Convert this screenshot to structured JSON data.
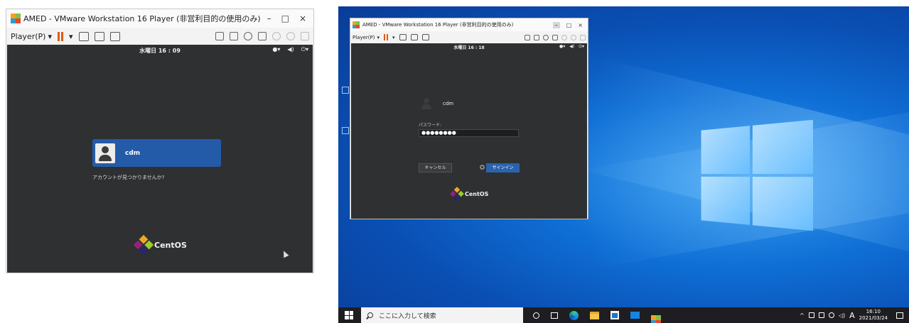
{
  "left_window": {
    "title": "AMED - VMware Workstation 16 Player (非営利目的の使用のみ)",
    "controls": {
      "minimize": "–",
      "maximize": "□",
      "close": "×"
    },
    "menu": {
      "player": "Player(P)",
      "caret": "▾"
    },
    "guest": {
      "clock": "水曜日 16 : 09",
      "user_name": "cdm",
      "account_not_found": "アカウントが見つかりませんか?",
      "brand": "CentOS"
    }
  },
  "right_window": {
    "title": "AMED - VMware Workstation 16 Player (非営利目的の使用のみ)",
    "controls": {
      "minimize": "–",
      "maximize": "□",
      "close": "×"
    },
    "menu": {
      "player": "Player(P)",
      "caret": "▾"
    },
    "guest": {
      "clock": "水曜日 16 : 18",
      "user_name": "cdm",
      "password_label": "パスワード:",
      "password_value": "●●●●●●●●",
      "cancel_button": "キャンセル",
      "signin_button": "サインイン",
      "brand": "CentOS"
    }
  },
  "taskbar": {
    "search_placeholder": "ここに入力して検索",
    "tray_caret": "^",
    "ime": "A",
    "time": "16:10",
    "date": "2021/03/24"
  },
  "colors": {
    "guest_bg": "#2e3032",
    "selected_user": "#245ba9",
    "signin_button": "#2a63ad",
    "pause_icon": "#e05a17",
    "taskbar": "#1e1e22"
  }
}
